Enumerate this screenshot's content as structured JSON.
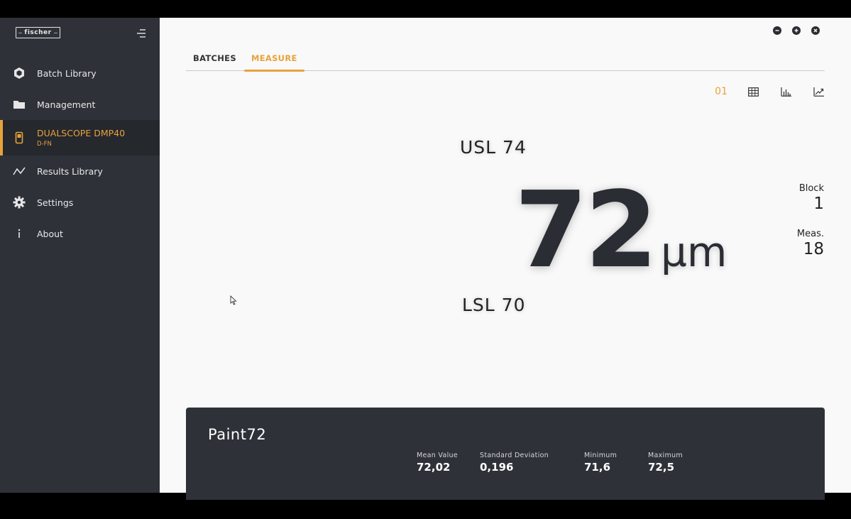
{
  "brand": {
    "logo_text": "fischer"
  },
  "sidebar": {
    "items": [
      {
        "label": "Batch Library",
        "icon": "hexagon-icon"
      },
      {
        "label": "Management",
        "icon": "folder-icon"
      },
      {
        "label": "DUALSCOPE DMP40",
        "sub": "D-FN",
        "icon": "device-icon",
        "active": true
      },
      {
        "label": "Results Library",
        "icon": "graph-icon"
      },
      {
        "label": "Settings",
        "icon": "gear-icon"
      },
      {
        "label": "About",
        "icon": "info-icon"
      }
    ]
  },
  "tabs": [
    {
      "label": "BATCHES",
      "active": false
    },
    {
      "label": "MEASURE",
      "active": true
    }
  ],
  "view_tools": {
    "channel": "01"
  },
  "measurement": {
    "usl": "USL 74",
    "lsl": "LSL 70",
    "value": "72",
    "unit": "µm",
    "block_label": "Block",
    "block_value": "1",
    "meas_label": "Meas.",
    "meas_value": "18"
  },
  "batch": {
    "name": "Paint72",
    "stats": [
      {
        "label": "Mean Value",
        "value": "72,02"
      },
      {
        "label": "Standard Deviation",
        "value": "0,196"
      },
      {
        "label": "Minimum",
        "value": "71,6"
      },
      {
        "label": "Maximum",
        "value": "72,5"
      }
    ]
  },
  "colors": {
    "accent": "#e8a23c",
    "sidebar_bg": "#2e3238",
    "main_bg": "#f9f9f9"
  }
}
